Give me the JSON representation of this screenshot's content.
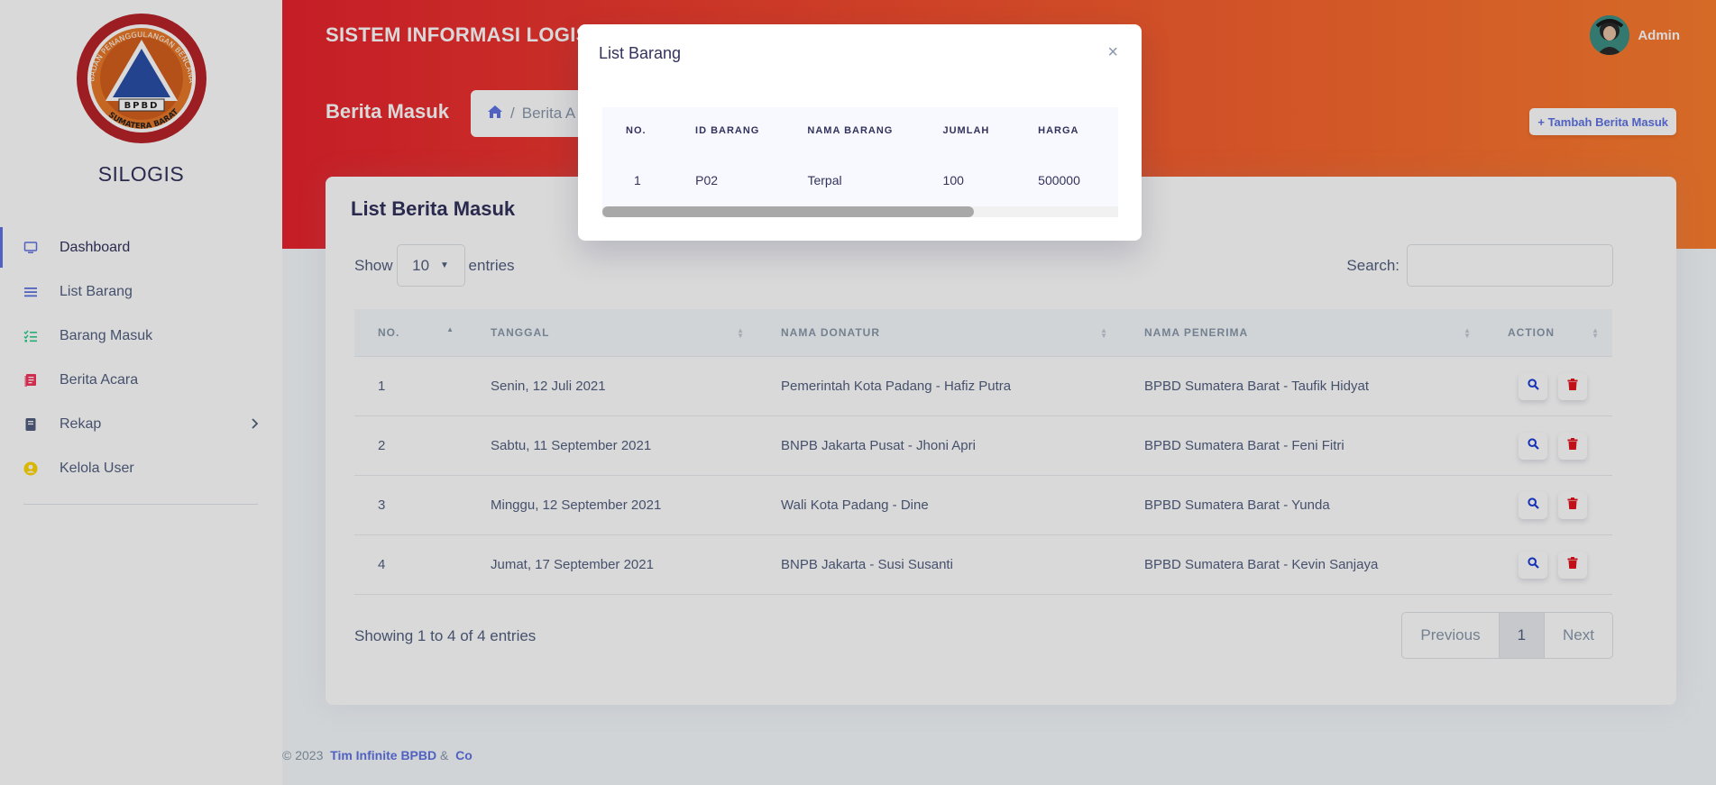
{
  "sidebar": {
    "brand": "SILOGIS",
    "logo": {
      "arc_text": "BADAN PENANGGULANGAN BENCANA DAERAH",
      "center_text": "BPBD",
      "bottom_text": "SUMATERA BARAT"
    },
    "items": [
      {
        "label": "Dashboard",
        "icon": "monitor-icon",
        "color": "#5e72e4"
      },
      {
        "label": "List Barang",
        "icon": "list-icon",
        "color": "#5e72e4"
      },
      {
        "label": "Barang Masuk",
        "icon": "checklist-icon",
        "color": "#2dce89"
      },
      {
        "label": "Berita Acara",
        "icon": "document-icon",
        "color": "#f5365c"
      },
      {
        "label": "Rekap",
        "icon": "book-icon",
        "color": "#525f7f"
      },
      {
        "label": "Kelola User",
        "icon": "user-circle-icon",
        "color": "#ffd600"
      }
    ]
  },
  "header": {
    "app_title": "SISTEM INFORMASI LOGISTIK",
    "user_name": "Admin",
    "page_title": "Berita Masuk",
    "breadcrumb_current": "Berita A",
    "add_button": "+ Tambah Berita Masuk"
  },
  "card": {
    "title": "List Berita Masuk",
    "show_label": "Show",
    "entries_value": "10",
    "entries_label": "entries",
    "search_label": "Search:",
    "columns": [
      "NO.",
      "TANGGAL",
      "NAMA DONATUR",
      "NAMA PENERIMA",
      "ACTION"
    ],
    "rows": [
      {
        "no": "1",
        "tanggal": "Senin, 12 Juli 2021",
        "donatur": "Pemerintah Kota Padang - Hafiz Putra",
        "penerima": "BPBD Sumatera Barat - Taufik Hidyat"
      },
      {
        "no": "2",
        "tanggal": "Sabtu, 11 September 2021",
        "donatur": "BNPB Jakarta Pusat - Jhoni Apri",
        "penerima": "BPBD Sumatera Barat - Feni Fitri"
      },
      {
        "no": "3",
        "tanggal": "Minggu, 12 September 2021",
        "donatur": "Wali Kota Padang - Dine",
        "penerima": "BPBD Sumatera Barat - Yunda"
      },
      {
        "no": "4",
        "tanggal": "Jumat, 17 September 2021",
        "donatur": "BNPB Jakarta - Susi Susanti",
        "penerima": "BPBD Sumatera Barat - Kevin Sanjaya"
      }
    ],
    "info": "Showing 1 to 4 of 4 entries",
    "pager": {
      "previous": "Previous",
      "page": "1",
      "next": "Next"
    }
  },
  "footer": {
    "copyright": "© 2023",
    "link1": "Tim Infinite BPBD",
    "amp": "&",
    "link2": "Co"
  },
  "modal": {
    "title": "List Barang",
    "close": "×",
    "columns": [
      "NO.",
      "ID BARANG",
      "NAMA BARANG",
      "JUMLAH",
      "HARGA"
    ],
    "rows": [
      {
        "no": "1",
        "id": "P02",
        "nama": "Terpal",
        "jumlah": "100",
        "harga": "500000"
      }
    ],
    "scroll_fraction": 0.72
  },
  "colors": {
    "primary": "#5e72e4",
    "header_start": "#e8232e",
    "header_end": "#fb7d2e",
    "danger": "#f5365c"
  }
}
